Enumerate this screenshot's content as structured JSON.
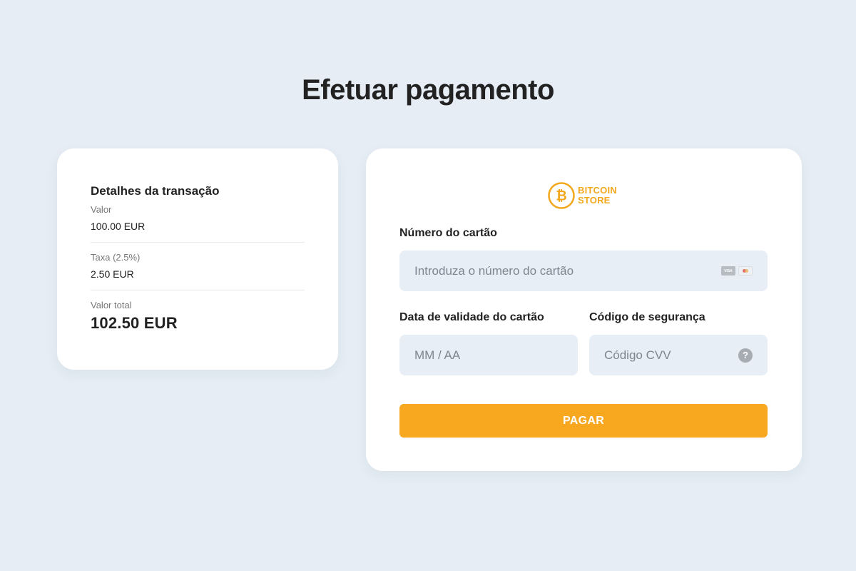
{
  "page": {
    "title": "Efetuar pagamento"
  },
  "summary": {
    "heading": "Detalhes da transação",
    "amount_label": "Valor",
    "amount_value": "100.00 EUR",
    "fee_label": "Taxa (2.5%)",
    "fee_value": "2.50 EUR",
    "total_label": "Valor total",
    "total_value": "102.50 EUR"
  },
  "brand": {
    "name_line1": "BITCOIN",
    "name_line2": "STORE",
    "icon": "bitcoin-logo-icon",
    "color": "#f3a81c"
  },
  "form": {
    "card_number_label": "Número do cartão",
    "card_number_placeholder": "Introduza o número do cartão",
    "card_icons": [
      "visa-card-icon",
      "mastercard-icon"
    ],
    "visa_text": "VISA",
    "expiry_label": "Data de validade do cartão",
    "expiry_placeholder": "MM / AA",
    "cvv_label": "Código de segurança",
    "cvv_placeholder": "Código CVV",
    "cvv_help_icon": "help-icon",
    "cvv_help_glyph": "?",
    "pay_label": "PAGAR"
  },
  "colors": {
    "background": "#e6edf4",
    "accent": "#f7a81e",
    "input_background": "#e8eef5",
    "card_background": "#ffffff"
  }
}
